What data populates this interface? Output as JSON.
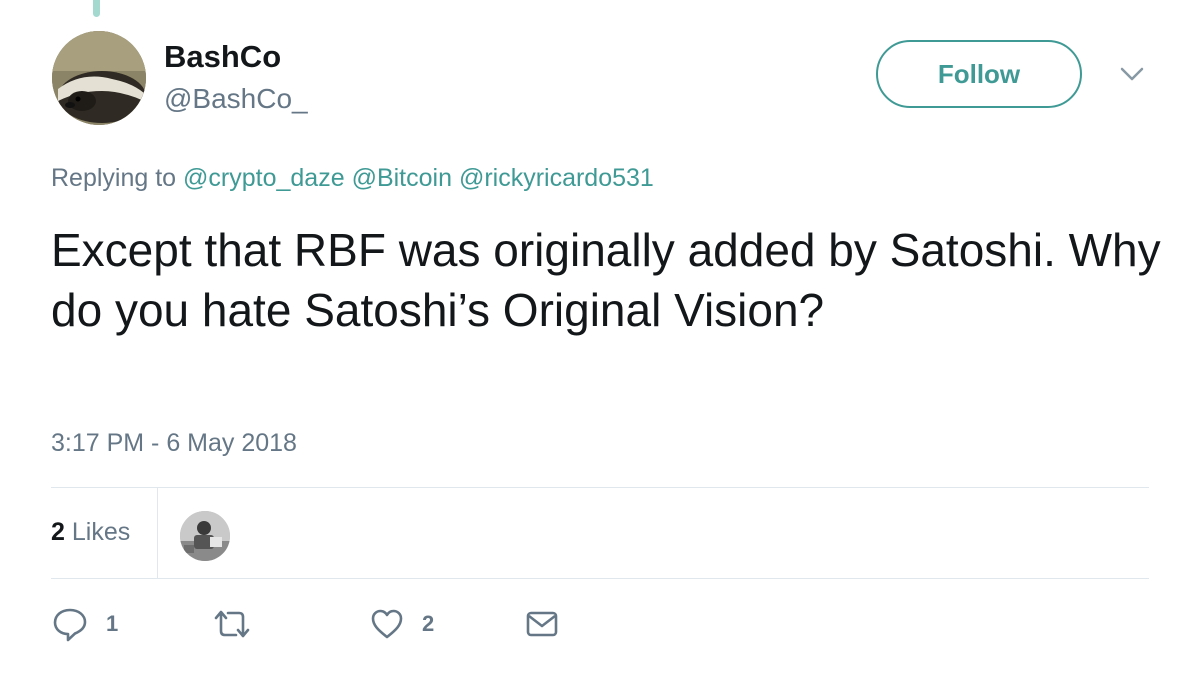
{
  "author": {
    "display_name": "BashCo",
    "handle": "@BashCo_"
  },
  "follow_button": {
    "label": "Follow"
  },
  "reply_context": {
    "prefix": "Replying to",
    "mentions": [
      "@crypto_daze",
      "@Bitcoin",
      "@rickyricardo531"
    ]
  },
  "tweet": {
    "text": "Except that RBF was originally added by Satoshi. Why do you hate Satoshi’s Original Vision?",
    "timestamp": "3:17 PM - 6 May 2018"
  },
  "stats": {
    "likes_count": "2",
    "likes_label": "Likes"
  },
  "actions": {
    "reply_count": "1",
    "retweet_count": "",
    "like_count": "2"
  },
  "icons": {
    "reply": "reply-icon",
    "retweet": "retweet-icon",
    "like": "heart-icon",
    "message": "envelope-icon",
    "menu": "chevron-down-icon"
  },
  "colors": {
    "accent": "#3f9a95",
    "secondary_text": "#657786",
    "primary_text": "#14171a",
    "divider": "#e1e8ed"
  }
}
